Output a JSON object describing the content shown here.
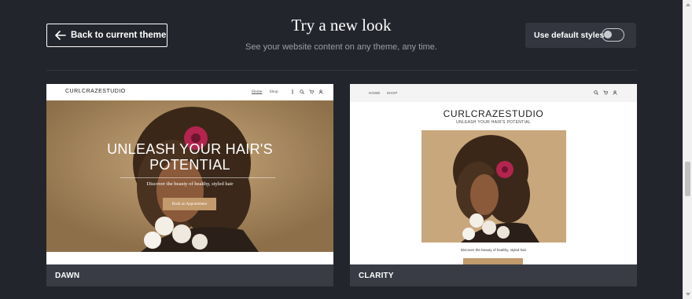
{
  "header": {
    "back_label": "Back to current theme",
    "title": "Try a new look",
    "subtitle": "See your website content on any theme, any time.",
    "toggle_label": "Use default styles",
    "toggle_on": false
  },
  "themes": [
    {
      "name": "DAWN",
      "preview": {
        "logo": "CURLCRAZESTUDIO",
        "nav_links": [
          "Home",
          "Shop"
        ],
        "hero_title_line1": "UNLEASH YOUR HAIR'S",
        "hero_title_line2": "POTENTIAL",
        "hero_subtitle": "Discover the beauty of healthy, styled hair",
        "cta_label": "Book an Appointment"
      }
    },
    {
      "name": "CLARITY",
      "preview": {
        "nav_links": [
          "HOME",
          "SHOP"
        ],
        "logo": "CURLCRAZESTUDIO",
        "tagline": "UNLEASH YOUR HAIR'S POTENTIAL",
        "caption": "Discover the beauty of healthy, styled hair"
      }
    }
  ],
  "colors": {
    "background": "#23252c",
    "card_footer": "#393c45",
    "accent_button": "#c29a6c"
  }
}
